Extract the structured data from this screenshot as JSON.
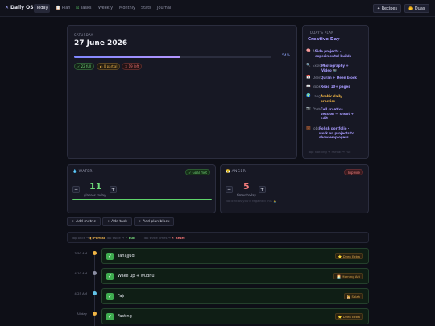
{
  "nav": {
    "brand": "Daily OS",
    "tabs": [
      "Today",
      "Plan",
      "Tasks",
      "Weekly",
      "Monthly",
      "Stats",
      "Journal"
    ],
    "right_buttons": [
      "Recipes",
      "Duas"
    ]
  },
  "day": {
    "kicker": "SATURDAY",
    "date": "27 June 2026",
    "progress": 0.54,
    "progress_label": "54%",
    "chips": {
      "full": "✓ 22 full",
      "partial": "◐ 0 partial",
      "left": "✕ 19 left"
    }
  },
  "plan": {
    "kicker": "TODAY'S PLAN",
    "title": "Creative Day",
    "rows": [
      {
        "icon": "🧠",
        "label": "AI",
        "value_lines": [
          "Side projects ·",
          "experimental builds"
        ],
        "gold": false
      },
      {
        "icon": "🔍",
        "label": "Explore",
        "value_lines": [
          "Photography +",
          "Video 📷"
        ],
        "gold": false
      },
      {
        "icon": "📅",
        "label": "Deen",
        "value_lines": [
          "Quran + Deen block"
        ],
        "gold": false
      },
      {
        "icon": "📖",
        "label": "Book",
        "value_lines": [
          "Read 10+ pages"
        ],
        "gold": false
      },
      {
        "icon": "🌍",
        "label": "Lang",
        "value_lines": [
          "Arabic daily",
          "practice"
        ],
        "gold": true
      },
      {
        "icon": "📷",
        "label": "Photo",
        "value_lines": [
          "Full creative",
          "session — shoot +",
          "edit"
        ],
        "gold": false
      },
      {
        "icon": "💼",
        "label": "Jobs",
        "value_lines": [
          "Polish portfolio ·",
          "work on projects to",
          "show employers"
        ],
        "gold": false
      }
    ],
    "footer": "Tap: Nothing → Partial → Full"
  },
  "water": {
    "label": "💧 WATER",
    "badge": "✓ Goal met",
    "minus": "−",
    "plus": "+",
    "count": "11",
    "unit": "glasses today",
    "goal_fraction": 1.0
  },
  "anger": {
    "label": "😤 ANGER",
    "badge": "Tripwire",
    "minus": "−",
    "plus": "+",
    "count": "5",
    "unit": "times today",
    "hint": "Noticed as you'd regained this 🙏"
  },
  "actions": [
    "+ Add metric",
    "+ Add task",
    "+ Add plan block"
  ],
  "legend": [
    {
      "muted": "Tap once →",
      "strong": "◐ Partial",
      "color": "#e9b04c"
    },
    {
      "muted": "Tap twice →",
      "strong": "✓ Full",
      "color": "#74d47a"
    },
    {
      "muted": "Tap three times →",
      "strong": "✗ Reset",
      "color": "#f07474"
    }
  ],
  "timeline": [
    {
      "time": "3:50 AM",
      "label": "Tahajjud",
      "tag": "⭐ Deen Extra",
      "dot": "#f0b545"
    },
    {
      "time": "4:10 AM",
      "label": "Wake up + wudhu",
      "tag": "🌅 Morning Act",
      "dot": "#8b8ea3"
    },
    {
      "time": "4:25 AM",
      "label": "Fajr",
      "tag": "🕌 Salah",
      "dot": "#62c3e8"
    },
    {
      "time": "All day",
      "label": "Fasting",
      "tag": "⭐ Deen Extra",
      "dot": "#f0b545"
    }
  ]
}
